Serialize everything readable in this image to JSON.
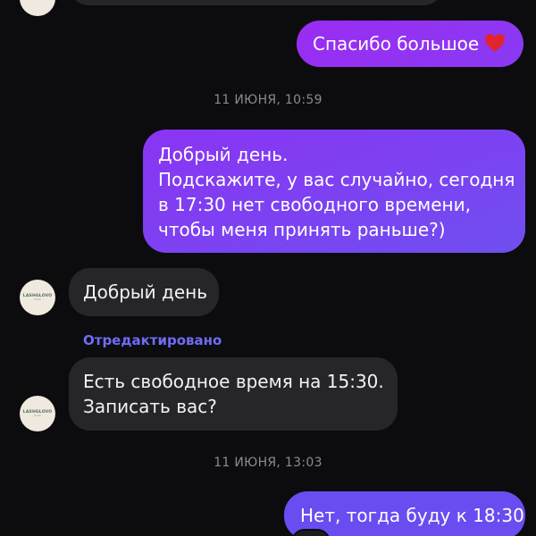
{
  "messages": {
    "thanks": "Спасибо большое",
    "ts1": "11 ИЮНЯ, 10:59",
    "question": {
      "line1": "Добрый день.",
      "line2": "Подскажите, у вас случайно, сегодня",
      "line3": "в 17:30 нет свободного времени,",
      "line4": "чтобы меня принять раньше?)"
    },
    "reply1": "Добрый день",
    "edited_label": "Отредактировано",
    "reply2": {
      "line1": "Есть свободное время на 15:30.",
      "line2": "Записать вас?"
    },
    "ts2": "11 ИЮНЯ, 13:03",
    "answer": "Нет, тогда буду к 18:30"
  },
  "avatar": {
    "logo": "LASHGLOVO",
    "sub": "studio"
  },
  "colors": {
    "background": "#0c0c0e",
    "incoming_bubble": "#26262a",
    "outgoing_purple": "#9a2cf2",
    "outgoing_violet": "#6a4cf0",
    "edited_text": "#6f6cf5",
    "heart": "#e0252f"
  },
  "icons": {
    "heart": "heart-emoji"
  }
}
